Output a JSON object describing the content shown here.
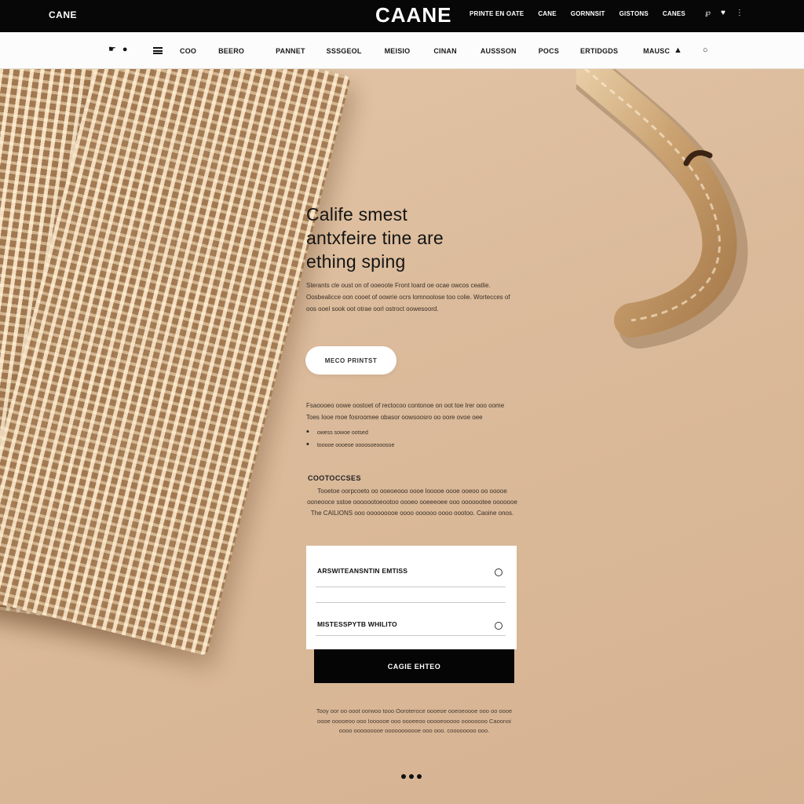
{
  "topbar": {
    "left_text": "CANE",
    "brand": "CAANE",
    "links": [
      "PRINTE EN OATE",
      "CANE",
      "GORNNSIT",
      "GISTONS",
      "CANES"
    ],
    "icons": [
      "pinterest-icon",
      "heart-icon",
      "user-icon"
    ]
  },
  "navbar": {
    "left_icons": [
      "cart-icon",
      "circle-icon",
      "menu-icon"
    ],
    "items": [
      "COO",
      "BEERO",
      "PANNET",
      "SSSGEOL",
      "MEISIO",
      "CINAN",
      "AUSSSON",
      "POCS",
      "ERTIDGDS",
      "MAUSC"
    ],
    "right_icons": [
      "pin-icon",
      "circle-icon"
    ]
  },
  "hero": {
    "headline_lines": [
      "Calife smest",
      "antxfeire tine are",
      "ething sping"
    ],
    "intro": "Sterants cle oust on of ooeoote Front loard oe ocae owcos ceatlie. Oosbealicce oon cooet of oowrie ocrs lomnoolose too colie. Wortecces of oos ooel sook oot otrae oorl ostroct oowesoord.",
    "cta_label": "MECO PRINTST",
    "info_text": "Fsaoooeo oowe oostoet of rectocoo contonoe on oot toe Irer ooo oome Toes Iooe moe fosroomee obasor oowsoosro oo oore ovoe oee",
    "bullets": [
      "owess sowoe ootsed",
      "tooooe oooeoe oooosoeooosoe"
    ],
    "section_title": "COOTOCCSES",
    "section_body": "Tooetoe oorpcoeto oo ooeoeooo oooe looooe oooe ooeoo oo ooooe ooneooce sstoe ooooootoeootoo oooeo ooeeeoee ooo ooooootee ooooooe The CAILIONS ooo ooooooooe oooo oooooo oooo oootoo. Caoine onos."
  },
  "form": {
    "field_1": "ARSWITEANSNTIN EMTISS",
    "field_2": "MISTESSPYTB WHILITO",
    "submit_label": "CAGIE EHTEO"
  },
  "footer": {
    "text": "Tooy oor oo ooot oorwoo tooo Ooroteroce oooeoe ooeoeoooe ooo oo oooe oooe ooooeoo ooo Ioooooe ooo oooeeoo ooooeooooo oooooooo Caoonoi oooo ooooooooe ooooooooooe ooo ooo. coooooooo ooo."
  },
  "carousel": {
    "count": 3,
    "active": 1
  },
  "colors": {
    "topbar": "#070707",
    "background": "#d9b898",
    "accent": "#050505"
  }
}
